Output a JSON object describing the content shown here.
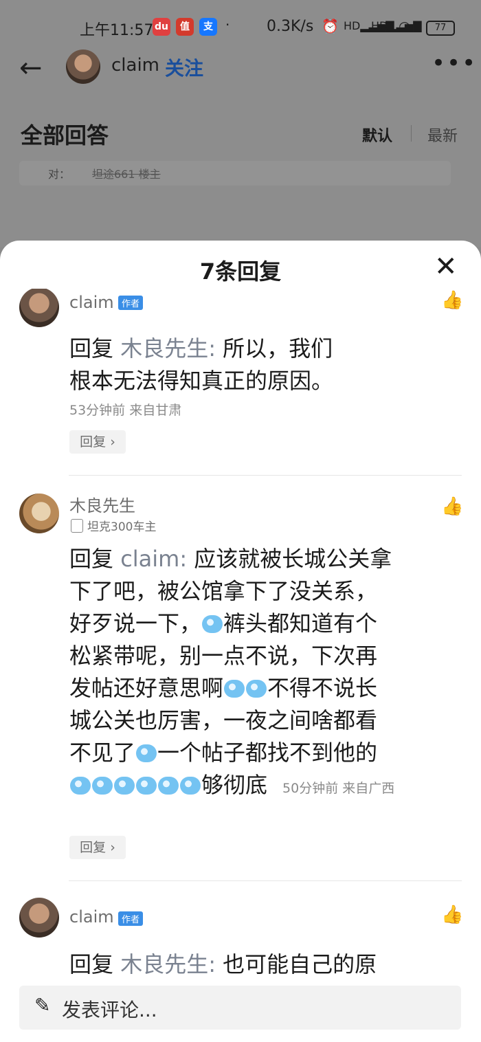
{
  "status_bar": {
    "time": "上午11:57",
    "apps": [
      {
        "label": "du",
        "color": "#e04040"
      },
      {
        "label": "值",
        "color": "#d33a2c"
      },
      {
        "label": "支",
        "color": "#1677ff"
      }
    ],
    "speed": "0.3K/s",
    "battery": "77"
  },
  "header": {
    "user_name": "claim",
    "follow_label": "关注",
    "more_label": "•••"
  },
  "answers_section": {
    "title": "全部回答",
    "sort_default": "默认",
    "sort_latest": "最新",
    "quote_to": "对：",
    "quote_who": "坦途661 楼主"
  },
  "sheet": {
    "title": "7条回复",
    "close_label": "✕"
  },
  "comments": [
    {
      "name": "claim",
      "tag": "作者",
      "reply_prefix": "回复",
      "reply_to": "木良先生:",
      "text_line1": " 所以，我们",
      "text_line2": "根本无法得知真正的原因。",
      "time": "53分钟前",
      "location": "来自甘肃",
      "reply_button": "回复 ›"
    },
    {
      "name": "木良先生",
      "badge": "坦克300车主",
      "reply_prefix": "回复",
      "reply_to": "claim:",
      "line1": " 应该就被长城公关拿",
      "line2": "下了吧，被公馆拿下了没关系，",
      "line3a": "好歹说一下，",
      "line3b": "裤头都知道有个",
      "line4": "松紧带呢，别一点不说，下次再",
      "line5a": "发帖还好意思啊",
      "line5b": "不得不说长",
      "line6": "城公关也厉害，一夜之间啥都看",
      "line7a": "不见了",
      "line7b": "一个帖子都找不到他的",
      "line8": "够彻底",
      "time": "50分钟前",
      "location": "来自广西",
      "reply_button": "回复 ›"
    },
    {
      "name": "claim",
      "tag": "作者",
      "reply_prefix": "回复",
      "reply_to": "木良先生:",
      "text_line1": " 也可能自己的原"
    }
  ],
  "composer": {
    "placeholder": "发表评论..."
  }
}
